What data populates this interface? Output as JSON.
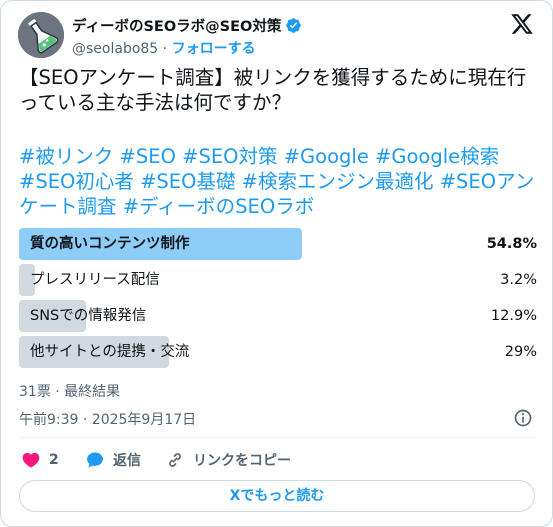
{
  "author": {
    "name": "ディーボのSEOラボ@SEO対策",
    "handle": "@seolabo85",
    "separator": "·",
    "follow_label": "フォローする"
  },
  "tweet": {
    "text": "【SEOアンケート調査】被リンクを獲得するために現在行っている主な手法は何ですか？",
    "hashtags": "#被リンク #SEO #SEO対策 #Google #Google検索 #SEO初心者 #SEO基礎 #検索エンジン最適化 #SEOアンケート調査 #ディーボのSEOラボ"
  },
  "poll": {
    "options": [
      {
        "label": "質の高いコンテンツ制作",
        "percent_text": "54.8%",
        "percent": 54.8
      },
      {
        "label": "プレスリリース配信",
        "percent_text": "3.2%",
        "percent": 3.2
      },
      {
        "label": "SNSでの情報発信",
        "percent_text": "12.9%",
        "percent": 12.9
      },
      {
        "label": "他サイトとの提携・交流",
        "percent_text": "29%",
        "percent": 29
      }
    ],
    "meta": "31票 · 最終結果"
  },
  "timestamp": "午前9:39 · 2025年9月17日",
  "actions": {
    "like_count": "2",
    "reply_label": "返信",
    "copy_link_label": "リンクをコピー"
  },
  "read_more_label": "Xでもっと読む",
  "colors": {
    "accent": "#1d9bf0",
    "winner_bar": "#8ecdf8",
    "bar": "#cfd9de",
    "like": "#f91880"
  },
  "icons": [
    "flask-avatar",
    "verified-badge-icon",
    "x-logo-icon",
    "info-icon",
    "heart-icon",
    "reply-bubble-icon",
    "link-icon"
  ]
}
